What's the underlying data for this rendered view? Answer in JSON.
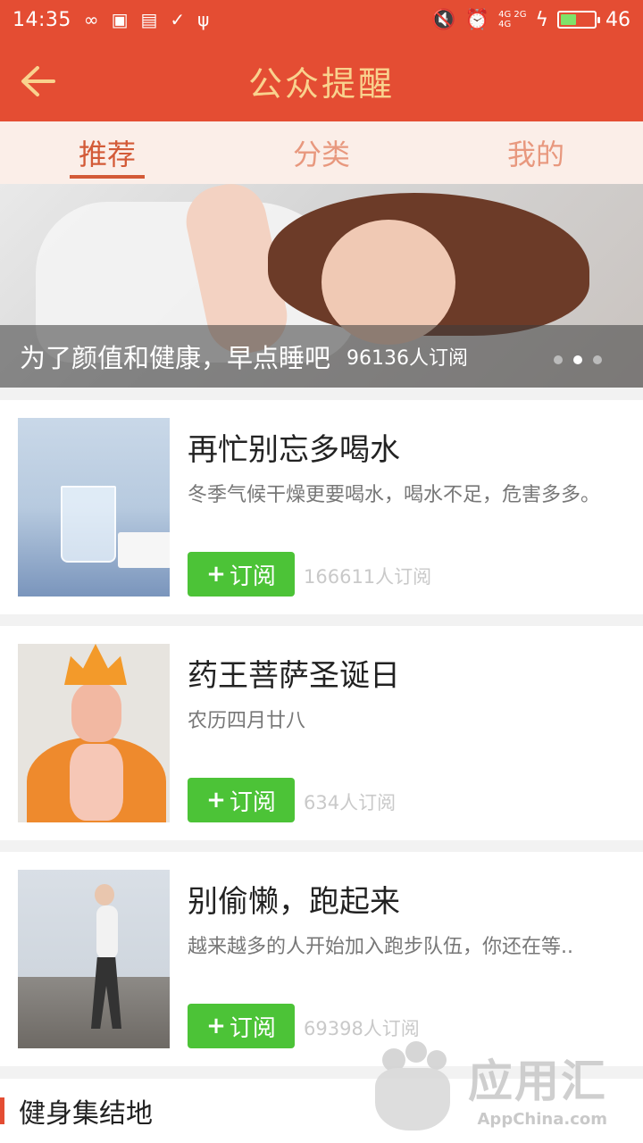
{
  "status_bar": {
    "time": "14:35",
    "network_top": "4G 2G",
    "network_bottom": "4G",
    "battery": "46",
    "battery_level": 0.46
  },
  "header": {
    "title": "公众提醒"
  },
  "tabs": [
    {
      "label": "推荐",
      "active": true
    },
    {
      "label": "分类",
      "active": false
    },
    {
      "label": "我的",
      "active": false
    }
  ],
  "banner": {
    "title": "为了颜值和健康，早点睡吧",
    "subscribers": "96136人订阅",
    "active_dot": 1
  },
  "cards": [
    {
      "title": "再忙别忘多喝水",
      "desc": "冬季气候干燥更要喝水，喝水不足，危害多多。",
      "button": "订阅",
      "plus": "+",
      "count": "166611人订阅",
      "thumb_icon": "water-glass-image"
    },
    {
      "title": "药王菩萨圣诞日",
      "desc": "农历四月廿八",
      "button": "订阅",
      "plus": "+",
      "count": "634人订阅",
      "thumb_icon": "bodhisattva-statue-image"
    },
    {
      "title": "别偷懒，跑起来",
      "desc": "越来越多的人开始加入跑步队伍，你还在等..",
      "button": "订阅",
      "plus": "+",
      "count": "69398人订阅",
      "thumb_icon": "runner-image"
    }
  ],
  "section": {
    "title": "健身集结地"
  },
  "watermark": {
    "name": "应用汇",
    "url": "AppChina.com"
  },
  "colors": {
    "primary": "#e44d33",
    "title_text": "#f9d28e",
    "subscribe_button": "#4cc337",
    "tab_background": "#fbeee8"
  }
}
